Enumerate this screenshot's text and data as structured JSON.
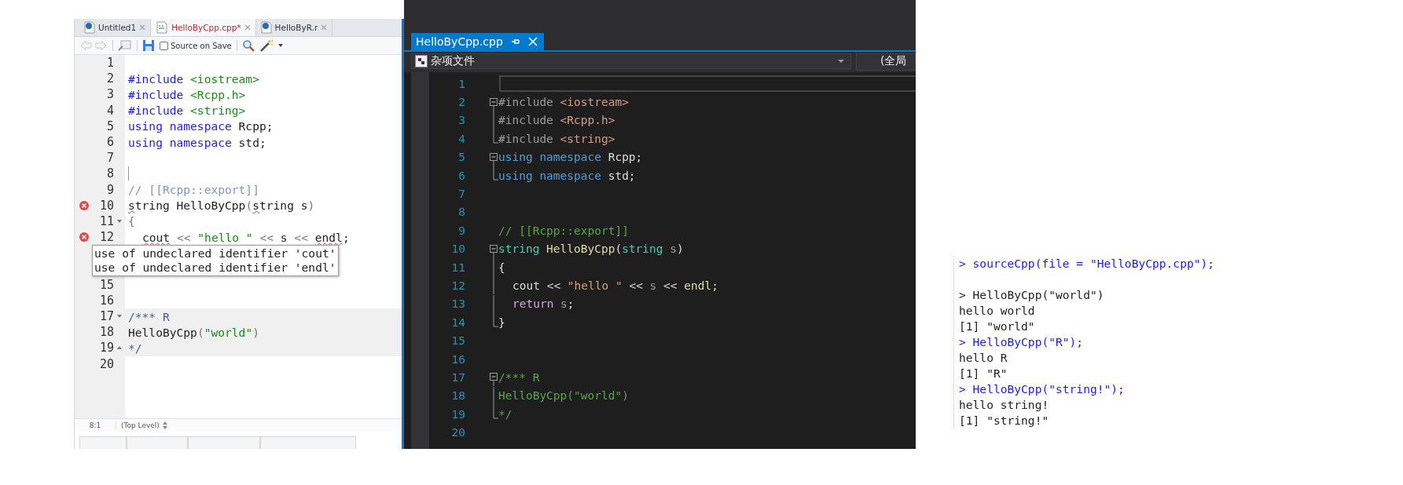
{
  "rstudio": {
    "tabs": [
      {
        "label": "Untitled1",
        "kind": "r",
        "selected": false,
        "modified": false
      },
      {
        "label": "HelloByCpp.cpp*",
        "kind": "cpp",
        "selected": true,
        "modified": true
      },
      {
        "label": "HelloByR.r",
        "kind": "r",
        "selected": false,
        "modified": false
      }
    ],
    "toolbar": {
      "source_on_save": {
        "label": "Source on Save",
        "checked": false
      }
    },
    "lines": [
      {
        "kind": "code",
        "number": "1"
      },
      {
        "kind": "code",
        "number": "2",
        "tokens": [
          {
            "t": "#include ",
            "kind": "pp"
          },
          {
            "t": "<iostream>",
            "kind": "inc"
          }
        ]
      },
      {
        "kind": "code",
        "number": "3",
        "tokens": [
          {
            "t": "#include ",
            "kind": "pp"
          },
          {
            "t": "<Rcpp.h>",
            "kind": "inc"
          }
        ]
      },
      {
        "kind": "code",
        "number": "4",
        "tokens": [
          {
            "t": "#include ",
            "kind": "pp"
          },
          {
            "t": "<string>",
            "kind": "inc"
          }
        ]
      },
      {
        "kind": "code",
        "number": "5",
        "tokens": [
          {
            "t": "using namespace",
            "kind": "kw"
          },
          {
            "t": " Rcpp;",
            "kind": "plain"
          }
        ]
      },
      {
        "kind": "code",
        "number": "6",
        "tokens": [
          {
            "t": "using namespace",
            "kind": "kw"
          },
          {
            "t": " std;",
            "kind": "plain"
          }
        ]
      },
      {
        "kind": "code",
        "number": "7"
      },
      {
        "kind": "code",
        "number": "8",
        "cursor": true
      },
      {
        "kind": "code",
        "number": "9",
        "tokens": [
          {
            "t": "// [[Rcpp::export]]",
            "kind": "cm"
          }
        ]
      },
      {
        "kind": "code",
        "number": "10",
        "error": true,
        "tokens": [
          {
            "t": "s",
            "kind": "plain",
            "squiggle": true
          },
          {
            "t": "tring HelloByCpp",
            "kind": "plain"
          },
          {
            "t": "(",
            "kind": "op"
          },
          {
            "t": "s",
            "kind": "plain",
            "squiggle": true
          },
          {
            "t": "tring s",
            "kind": "plain"
          },
          {
            "t": ")",
            "kind": "op"
          }
        ]
      },
      {
        "kind": "code",
        "number": "11",
        "fold_start": true,
        "tokens": [
          {
            "t": "{",
            "kind": "op"
          }
        ]
      },
      {
        "kind": "code",
        "number": "12",
        "error": true,
        "indented": true,
        "tokens": [
          {
            "t": "cout",
            "kind": "plain",
            "squiggle": true
          },
          {
            "t": " << ",
            "kind": "op"
          },
          {
            "t": "\"hello \"",
            "kind": "str"
          },
          {
            "t": " << ",
            "kind": "op"
          },
          {
            "t": "s",
            "kind": "plain"
          },
          {
            "t": " << ",
            "kind": "op"
          },
          {
            "t": "endl",
            "kind": "plain",
            "squiggle": true
          },
          {
            "t": ";",
            "kind": "plain"
          }
        ]
      },
      {
        "kind": "tooltip",
        "messages": [
          "use of undeclared identifier 'cout'",
          "use of undeclared identifier 'endl'"
        ]
      },
      {
        "kind": "code",
        "number": "15"
      },
      {
        "kind": "code",
        "number": "16"
      },
      {
        "kind": "code",
        "number": "17",
        "fold_start": true,
        "shaded": true,
        "tokens": [
          {
            "t": "/*** R",
            "kind": "block"
          }
        ]
      },
      {
        "kind": "code",
        "number": "18",
        "shaded": true,
        "tokens": [
          {
            "t": "HelloByCpp",
            "kind": "plain"
          },
          {
            "t": "(",
            "kind": "op"
          },
          {
            "t": "\"world\"",
            "kind": "str"
          },
          {
            "t": ")",
            "kind": "op"
          }
        ]
      },
      {
        "kind": "code",
        "number": "19",
        "fold_end": true,
        "shaded": true,
        "tokens": [
          {
            "t": "*/",
            "kind": "block"
          }
        ]
      },
      {
        "kind": "code",
        "number": "20"
      }
    ],
    "status_bar": {
      "position": "8:1",
      "scope": "(Top Level)"
    }
  },
  "visual_studio": {
    "tab": {
      "label": "HelloByCpp.cpp"
    },
    "project_dropdown": {
      "value": "杂项文件"
    },
    "scope_dropdown": {
      "value": "(全局"
    },
    "lines": [
      {
        "number": "1",
        "current": true
      },
      {
        "number": "2",
        "collapse_box": true,
        "tokens": [
          {
            "t": "#include ",
            "kind": "pp"
          },
          {
            "t": "<iostream>",
            "kind": "inc"
          }
        ]
      },
      {
        "number": "3",
        "guide": true,
        "tokens": [
          {
            "t": "#include ",
            "kind": "pp"
          },
          {
            "t": "<Rcpp.h>",
            "kind": "inc"
          }
        ]
      },
      {
        "number": "4",
        "guide_end": true,
        "tokens": [
          {
            "t": "#include ",
            "kind": "pp"
          },
          {
            "t": "<string>",
            "kind": "inc"
          }
        ]
      },
      {
        "number": "5",
        "collapse_box": true,
        "tokens": [
          {
            "t": "using namespace",
            "kind": "kw"
          },
          {
            "t": " Rcpp;",
            "kind": "plain"
          }
        ]
      },
      {
        "number": "6",
        "guide_end": true,
        "tokens": [
          {
            "t": "using namespace",
            "kind": "kw"
          },
          {
            "t": " std;",
            "kind": "plain"
          }
        ]
      },
      {
        "number": "7"
      },
      {
        "number": "8"
      },
      {
        "number": "9",
        "tokens": [
          {
            "t": "// [[Rcpp::export]]",
            "kind": "cm"
          }
        ]
      },
      {
        "number": "10",
        "collapse_box": true,
        "tokens": [
          {
            "t": "string",
            "kind": "type"
          },
          {
            "t": " HelloByCpp",
            "kind": "fn"
          },
          {
            "t": "(",
            "kind": "plain"
          },
          {
            "t": "string",
            "kind": "type"
          },
          {
            "t": " s",
            "kind": "param"
          },
          {
            "t": ")",
            "kind": "plain"
          }
        ]
      },
      {
        "number": "11",
        "guide": true,
        "tokens": [
          {
            "t": "{",
            "kind": "plain"
          }
        ]
      },
      {
        "number": "12",
        "guide": true,
        "indented": true,
        "tokens": [
          {
            "t": "cout << ",
            "kind": "plain"
          },
          {
            "t": "\"hello \"",
            "kind": "str"
          },
          {
            "t": " << ",
            "kind": "plain"
          },
          {
            "t": "s",
            "kind": "param"
          },
          {
            "t": " << ",
            "kind": "plain"
          },
          {
            "t": "endl",
            "kind": "fn"
          },
          {
            "t": ";",
            "kind": "plain"
          }
        ]
      },
      {
        "number": "13",
        "guide": true,
        "indented": true,
        "tokens": [
          {
            "t": "return",
            "kind": "ret"
          },
          {
            "t": " s",
            "kind": "param"
          },
          {
            "t": ";",
            "kind": "plain"
          }
        ]
      },
      {
        "number": "14",
        "guide_end": true,
        "tokens": [
          {
            "t": "}",
            "kind": "plain"
          }
        ]
      },
      {
        "number": "15"
      },
      {
        "number": "16"
      },
      {
        "number": "17",
        "collapse_box": true,
        "tokens": [
          {
            "t": "/*** R",
            "kind": "cm"
          }
        ]
      },
      {
        "number": "18",
        "guide": true,
        "tokens": [
          {
            "t": "HelloByCpp(\"world\")",
            "kind": "cm"
          }
        ]
      },
      {
        "number": "19",
        "guide_end": true,
        "tokens": [
          {
            "t": "*/",
            "kind": "cm"
          }
        ]
      },
      {
        "number": "20"
      }
    ]
  },
  "console": {
    "lines": [
      {
        "kind": "input",
        "text": "> sourceCpp(file = \"HelloByCpp.cpp\");"
      },
      {
        "kind": "blank"
      },
      {
        "kind": "output",
        "text": "> HelloByCpp(\"world\")"
      },
      {
        "kind": "output",
        "text": "hello world"
      },
      {
        "kind": "output",
        "text": "[1] \"world\""
      },
      {
        "kind": "input",
        "text": "> HelloByCpp(\"R\");"
      },
      {
        "kind": "output",
        "text": "hello R"
      },
      {
        "kind": "output",
        "text": "[1] \"R\""
      },
      {
        "kind": "input",
        "text": "> HelloByCpp(\"string!\");"
      },
      {
        "kind": "output",
        "text": "hello string!"
      },
      {
        "kind": "output",
        "text": "[1] \"string!\""
      }
    ]
  }
}
